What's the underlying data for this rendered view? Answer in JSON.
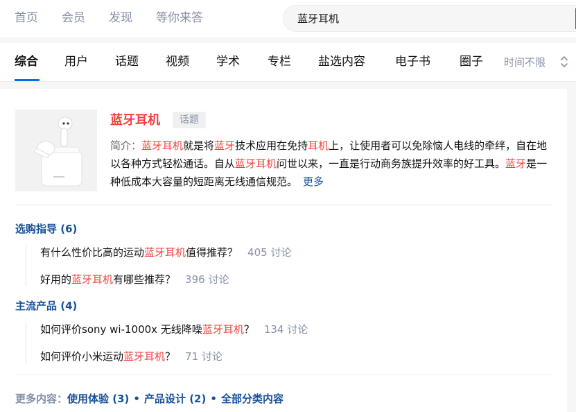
{
  "topnav": {
    "items": [
      "首页",
      "会员",
      "发现",
      "等你来答"
    ]
  },
  "search": {
    "value": "蓝牙耳机"
  },
  "tabs": [
    "综合",
    "用户",
    "话题",
    "视频",
    "学术",
    "专栏",
    "盐选内容",
    "电子书",
    "圈子"
  ],
  "time_filter": "时间不限",
  "topic": {
    "title": "蓝牙耳机",
    "tag": "话题",
    "intro_label": "简介：",
    "intro_parts": [
      {
        "t": "蓝牙耳机",
        "hl": true
      },
      {
        "t": "就是将",
        "hl": false
      },
      {
        "t": "蓝牙",
        "hl": true
      },
      {
        "t": "技术应用在免持",
        "hl": false
      },
      {
        "t": "耳机",
        "hl": true
      },
      {
        "t": "上，让使用者可以免除恼人电线的牵绊，自在地以各种方式轻松通话。自从",
        "hl": false
      },
      {
        "t": "蓝牙耳机",
        "hl": true
      },
      {
        "t": "问世以来，一直是行动商务族提升效率的好工具。",
        "hl": false
      },
      {
        "t": "蓝牙",
        "hl": true
      },
      {
        "t": "是一种低成本大容量的短距离无线通信规范。",
        "hl": false
      }
    ],
    "more": "更多"
  },
  "sections": [
    {
      "title": "选购指导 (6)",
      "items": [
        {
          "pre": "有什么性价比高的运动",
          "hl": "蓝牙耳机",
          "post": "值得推荐？",
          "count": "405 讨论"
        },
        {
          "pre": "好用的",
          "hl": "蓝牙耳机",
          "post": "有哪些推荐？",
          "count": "396 讨论"
        }
      ]
    },
    {
      "title": "主流产品 (4)",
      "items": [
        {
          "pre": "如何评价sony wi-1000x 无线降噪",
          "hl": "蓝牙耳机",
          "post": "？",
          "count": "134 讨论"
        },
        {
          "pre": "如何评价小米运动",
          "hl": "蓝牙耳机",
          "post": "？",
          "count": "71 讨论"
        }
      ]
    }
  ],
  "more_content": {
    "label": "更多内容：",
    "links": [
      "使用体验 (3)",
      "产品设计 (2)",
      "全部分类内容"
    ],
    "separator": "•"
  },
  "colors": {
    "accent": "#056de8",
    "highlight": "#f1403c",
    "link": "#175199",
    "muted": "#8590a6"
  }
}
